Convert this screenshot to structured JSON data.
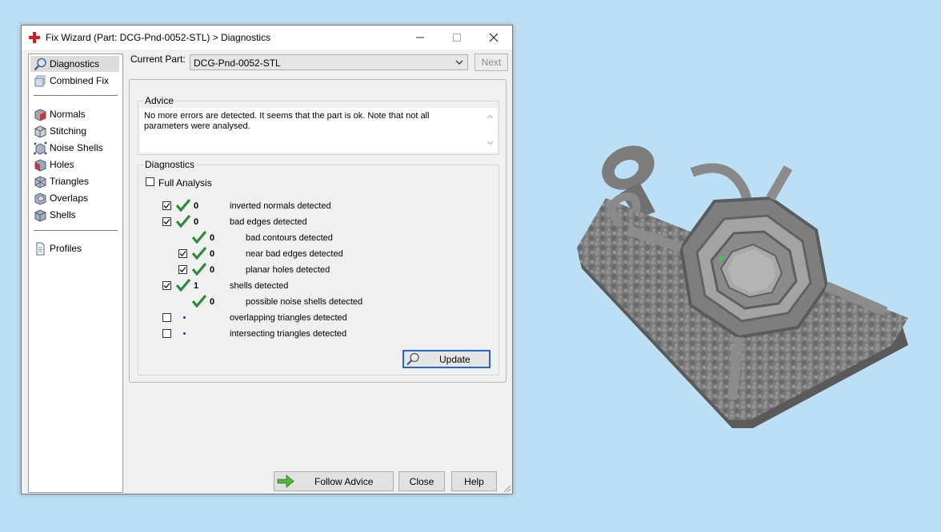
{
  "window": {
    "title": "Fix Wizard (Part: DCG-Pnd-0052-STL) > Diagnostics",
    "icons": {
      "app": "red-cross-icon",
      "minimize": "minimize-icon",
      "maximize": "maximize-icon",
      "close": "close-icon"
    }
  },
  "sidebar": {
    "items": [
      {
        "label": "Diagnostics",
        "icon": "magnifier-icon",
        "selected": true
      },
      {
        "label": "Combined Fix",
        "icon": "combined-fix-icon"
      },
      {
        "label": "Normals",
        "icon": "normals-cube-icon"
      },
      {
        "label": "Stitching",
        "icon": "stitching-cube-icon"
      },
      {
        "label": "Noise Shells",
        "icon": "noise-shells-icon"
      },
      {
        "label": "Holes",
        "icon": "holes-cube-icon"
      },
      {
        "label": "Triangles",
        "icon": "triangles-cube-icon"
      },
      {
        "label": "Overlaps",
        "icon": "overlaps-cube-icon"
      },
      {
        "label": "Shells",
        "icon": "shells-cube-icon"
      },
      {
        "label": "Profiles",
        "icon": "document-icon"
      }
    ]
  },
  "current_part": {
    "label": "Current Part:",
    "value": "DCG-Pnd-0052-STL",
    "next_label": "Next"
  },
  "advice": {
    "title": "Advice",
    "text": "No more errors are detected. It seems that the part is ok. Note that not all parameters were analysed."
  },
  "diagnostics": {
    "title": "Diagnostics",
    "full_analysis_label": "Full Analysis",
    "rows": [
      {
        "checked": true,
        "status": "ok",
        "count": "0",
        "label": "inverted normals detected"
      },
      {
        "checked": true,
        "status": "ok",
        "count": "0",
        "label": "bad edges detected"
      },
      {
        "checkbox": false,
        "status": "ok",
        "count": "0",
        "label": "bad contours detected"
      },
      {
        "checked": true,
        "status": "ok",
        "count": "0",
        "label": "near bad edges detected"
      },
      {
        "checked": true,
        "status": "ok",
        "count": "0",
        "label": "planar holes detected"
      },
      {
        "checked": true,
        "status": "ok",
        "count": "1",
        "label": "shells detected"
      },
      {
        "checkbox": false,
        "status": "ok",
        "count": "0",
        "label": "possible noise shells detected"
      },
      {
        "checked": false,
        "status": "not-analysed",
        "count": "",
        "label": "overlapping triangles detected"
      },
      {
        "checked": false,
        "status": "not-analysed",
        "count": "",
        "label": "intersecting triangles detected"
      }
    ],
    "update_label": "Update"
  },
  "buttons": {
    "follow_advice": "Follow Advice",
    "close": "Close",
    "help": "Help"
  },
  "colors": {
    "desktop": "#bcdff6",
    "ok_tick": "#2e8b3a",
    "pending_dot": "#1f2fb5",
    "focus_border": "#2a64c8"
  }
}
